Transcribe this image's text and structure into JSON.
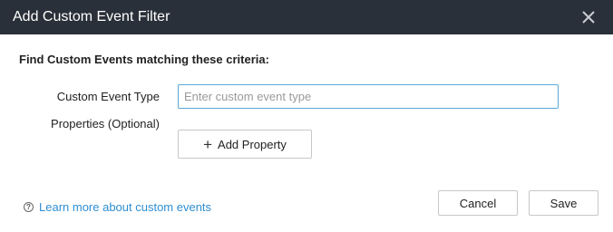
{
  "dialog": {
    "title": "Add Custom Event Filter",
    "close_icon": "close-icon"
  },
  "form": {
    "heading": "Find Custom Events matching these criteria:",
    "event_type_label": "Custom Event Type",
    "event_type_placeholder": "Enter custom event type",
    "event_type_value": "",
    "properties_label": "Properties (Optional)",
    "add_property_icon": "plus-icon",
    "add_property_label": "Add Property"
  },
  "footer": {
    "help_icon": "question-circle-icon",
    "learn_more_link": "Learn more about custom events",
    "cancel_label": "Cancel",
    "save_label": "Save"
  },
  "colors": {
    "titlebar_bg": "#2a3039",
    "link": "#2f8fd3",
    "input_focus_border": "#5aa8d9"
  }
}
